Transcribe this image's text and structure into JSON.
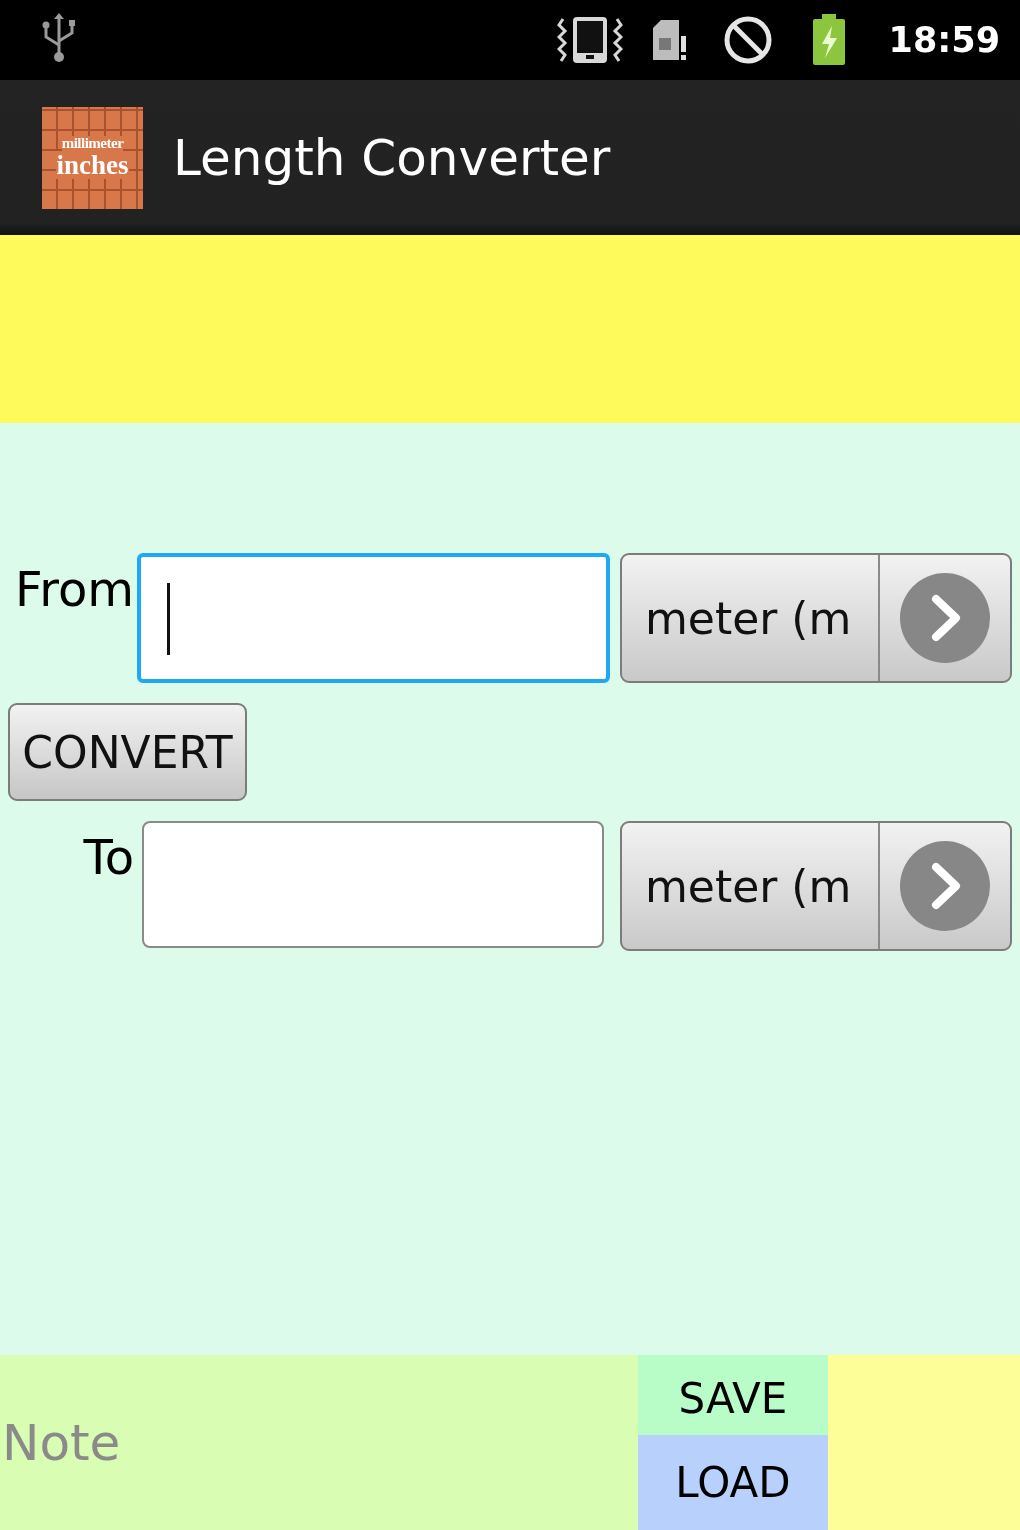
{
  "status_bar": {
    "time": "18:59"
  },
  "action_bar": {
    "title": "Length Converter",
    "logo_text": [
      "millimeter",
      "inches"
    ]
  },
  "converter": {
    "from": {
      "label": "From",
      "focused": true,
      "unit": "meter (m"
    },
    "convert_button": "CONVERT",
    "to": {
      "label": "To",
      "focused": false,
      "unit": "meter (m"
    }
  },
  "bottom_bar": {
    "note": {
      "placeholder": "Note"
    },
    "buttons": [
      {
        "label": "SAVE",
        "color": "#b8fcc8"
      },
      {
        "label": "LOAD",
        "color": "#b8d0fc"
      }
    ]
  }
}
